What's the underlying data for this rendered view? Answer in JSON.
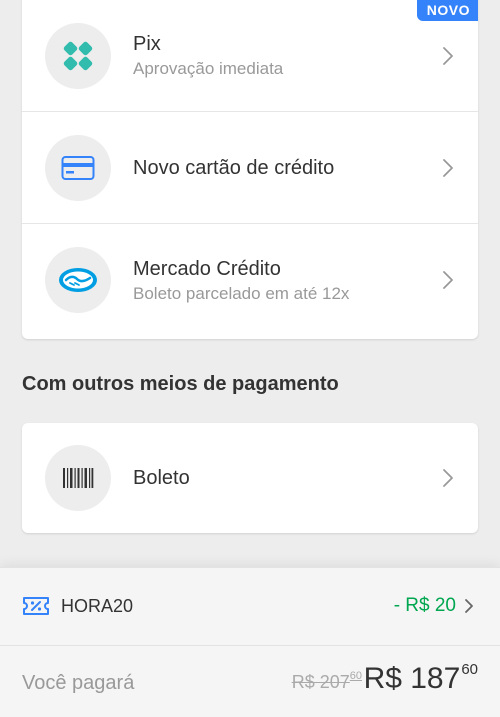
{
  "payment_methods": {
    "badge": "NOVO",
    "items": [
      {
        "title": "Pix",
        "subtitle": "Aprovação imediata",
        "icon": "pix-icon"
      },
      {
        "title": "Novo cartão de crédito",
        "subtitle": "",
        "icon": "credit-card-icon"
      },
      {
        "title": "Mercado Crédito",
        "subtitle": "Boleto parcelado em até 12x",
        "icon": "mercado-credito-icon"
      }
    ]
  },
  "other_methods": {
    "section_title": "Com outros meios de pagamento",
    "items": [
      {
        "title": "Boleto",
        "icon": "barcode-icon"
      }
    ]
  },
  "footer": {
    "coupon": {
      "code": "HORA20",
      "discount": "- R$ 20",
      "icon": "coupon-icon"
    },
    "total_label": "Você pagará",
    "old_price": {
      "main": "R$ 207",
      "cents": "60"
    },
    "new_price": {
      "main": "R$ 187",
      "cents": "60"
    }
  },
  "colors": {
    "accent": "#3483fa",
    "pix": "#32bcad",
    "discount": "#00a650"
  }
}
